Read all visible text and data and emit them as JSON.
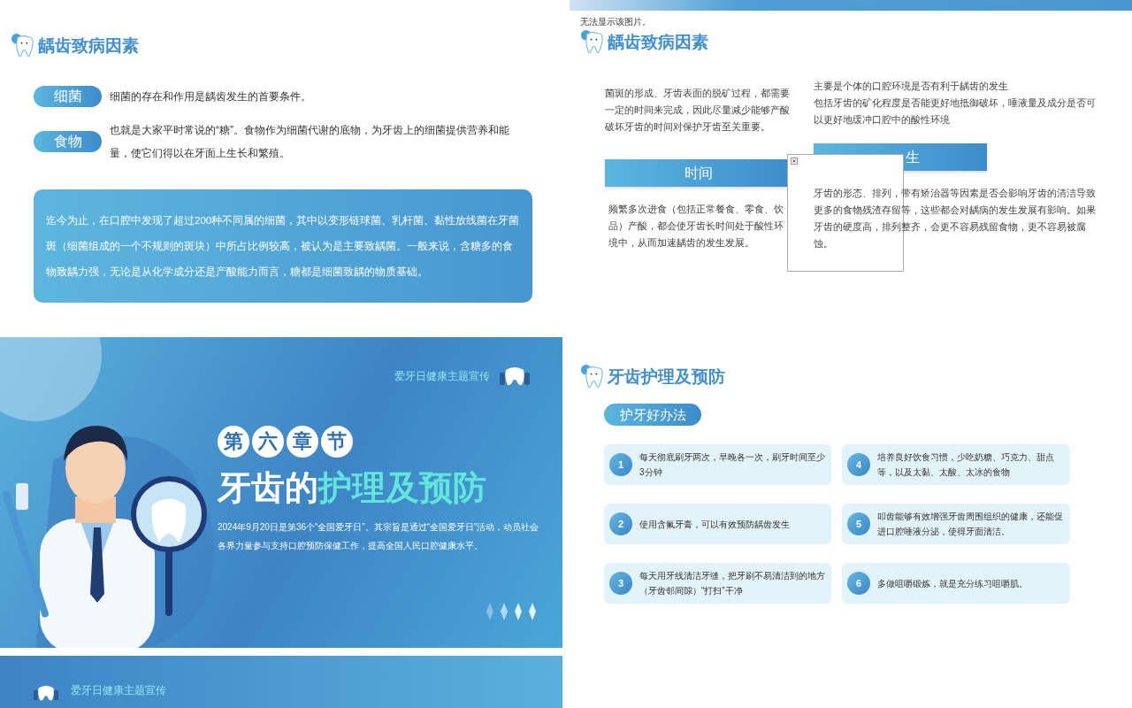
{
  "slide_1": {
    "title": "龋齿致病因素",
    "factors": [
      {
        "tag": "细菌",
        "text": "细菌的存在和作用是龋齿发生的首要条件。"
      },
      {
        "tag": "食物",
        "text": "也就是大家平时常说的“糖”。食物作为细菌代谢的底物，为牙齿上的细菌提供营养和能量，使它们得以在牙面上生长和繁殖。"
      }
    ],
    "callout": "迄今为止，在口腔中发现了超过200种不同属的细菌，其中以变形链球菌、乳杆菌、黏性放线菌在牙菌斑（细菌组成的一个不规则的斑块）中所占比例较高，被认为是主要致龋菌。一般来说，含糖多的食物致龋力强，无论是从化学成分还是产酸能力而言，糖都是细菌致龋的物质基础。"
  },
  "slide_2": {
    "image_error": "无法显示该图片。",
    "title": "龋齿致病因素",
    "columns": [
      {
        "intro": [
          "菌斑的形成、牙齿表面的脱矿过程，都需要一定的时间来完成，因此尽量减少能够产酸破坏牙齿的时间对保护牙齿至关重要。"
        ],
        "header": "时间",
        "text": "频繁多次进食（包括正常餐食、零食、饮品）产酸，都会使牙齿长时间处于酸性环境中，从而加速龋齿的发生发展。"
      },
      {
        "intro": [
          "主要是个体的口腔环境是否有利于龋齿的发生",
          "包括牙齿的矿化程度是否能更好地抵御破坏，唾液量及成分是否可以更好地缓冲口腔中的酸性环境"
        ],
        "header": "生",
        "text": "牙齿的形态、排列，带有矫治器等因素是否会影响牙齿的清洁导致更多的食物残渣存留等，这些都会对龋病的发生发展有影响。如果牙齿的硬度高，排列整齐，会更不容易残留食物，更不容易被腐蚀。"
      }
    ]
  },
  "slide_3": {
    "tagline": "爱牙日健康主题宣传",
    "chapter": [
      "第",
      "六",
      "章",
      "节"
    ],
    "title_plain": "牙齿的",
    "title_accent": "护理及预防",
    "description": "2024年9月20日是第36个“全国爱牙日”。其宗旨是通过“全国爱牙日”活动，动员社会各界力量参与支持口腔预防保健工作，提高全国人民口腔健康水平。"
  },
  "slide_4": {
    "title": "牙齿护理及预防",
    "section": "护牙好办法",
    "tips": [
      {
        "number": "1",
        "text": "每天彻底刷牙两次，早晚各一次，刷牙时间至少3分钟"
      },
      {
        "number": "2",
        "text": "使用含氟牙膏，可以有效预防龋齿发生"
      },
      {
        "number": "3",
        "text": "每天用牙线清洁牙缝，把牙刷不易清洁到的地方（牙齿邻间隙）“打扫”干净"
      },
      {
        "number": "4",
        "text": "培养良好饮食习惯，少吃奶糖、巧克力、甜点等，以及太黏、太酸、太冰的食物"
      },
      {
        "number": "5",
        "text": "叩齿能够有效增强牙齿周围组织的健康，还能促进口腔唾液分泌，使得牙面清洁。"
      },
      {
        "number": "6",
        "text": "多做咀嚼锻炼，就是充分练习咀嚼肌。"
      }
    ]
  },
  "slide_5": {
    "tagline": "爱牙日健康主题宣传"
  }
}
